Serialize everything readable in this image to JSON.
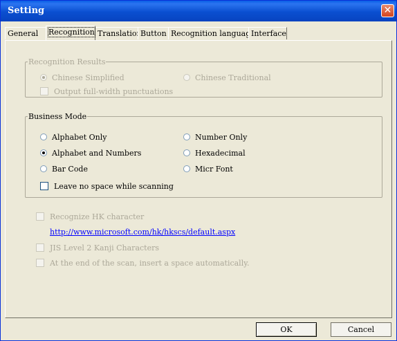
{
  "window": {
    "title": "Setting"
  },
  "tabs": [
    {
      "label": "General"
    },
    {
      "label": "Recognition"
    },
    {
      "label": "Translation"
    },
    {
      "label": "Button"
    },
    {
      "label": "Recognition language"
    },
    {
      "label": "Interface"
    }
  ],
  "active_tab": "Recognition",
  "recognition_results": {
    "legend": "Recognition Results",
    "enabled": false,
    "chinese_simplified": {
      "label": "Chinese Simplified",
      "selected": true
    },
    "chinese_traditional": {
      "label": "Chinese Traditional",
      "selected": false
    },
    "full_width": {
      "label": "Output full-width punctuations",
      "checked": false
    }
  },
  "business_mode": {
    "legend": "Business Mode",
    "alphabet_only": {
      "label": "Alphabet Only",
      "selected": false
    },
    "alphabet_numbers": {
      "label": "Alphabet and Numbers",
      "selected": true
    },
    "bar_code": {
      "label": "Bar Code",
      "selected": false
    },
    "number_only": {
      "label": "Number Only",
      "selected": false
    },
    "hexadecimal": {
      "label": "Hexadecimal",
      "selected": false
    },
    "micr_font": {
      "label": "Micr Font",
      "selected": false
    },
    "leave_no_space": {
      "label": "Leave no space while scanning",
      "checked": false
    }
  },
  "hk": {
    "label": "Recognize HK character",
    "checked": false,
    "enabled": false,
    "link": "http://www.microsoft.com/hk/hkscs/default.aspx"
  },
  "jis": {
    "label": "JIS Level 2 Kanji Characters",
    "checked": false,
    "enabled": false
  },
  "insert_space": {
    "label": "At the end of the scan, insert a space automatically.",
    "checked": false,
    "enabled": false
  },
  "buttons": {
    "ok": "OK",
    "cancel": "Cancel"
  }
}
